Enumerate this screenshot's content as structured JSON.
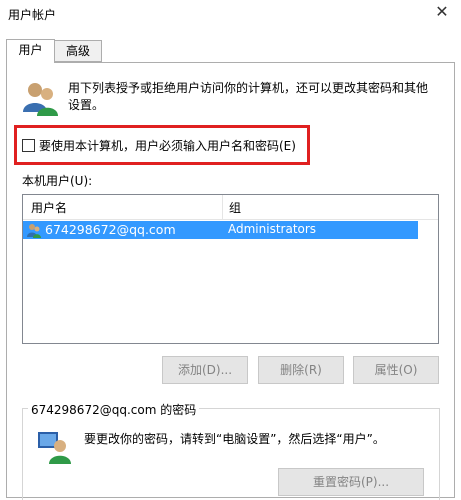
{
  "window": {
    "title": "用户帐户",
    "close_glyph": "✕"
  },
  "tabs": [
    {
      "label": "用户",
      "active": true
    },
    {
      "label": "高级",
      "active": false
    }
  ],
  "description": "用下列表授予或拒绝用户访问你的计算机，还可以更改其密码和其他设置。",
  "require_login": {
    "label": "要使用本计算机，用户必须输入用户名和密码(E)",
    "checked": false
  },
  "local_users": {
    "label": "本机用户(U):",
    "columns": [
      "用户名",
      "组"
    ],
    "rows": [
      {
        "name": "674298672@qq.com",
        "group": "Administrators",
        "selected": true
      }
    ]
  },
  "buttons": {
    "add": "添加(D)...",
    "remove": "删除(R)",
    "properties": "属性(O)"
  },
  "password_section": {
    "title": "674298672@qq.com 的密码",
    "text": "要更改你的密码，请转到“电脑设置”，然后选择“用户”。",
    "reset_button": "重置密码(P)..."
  },
  "colors": {
    "selection": "#3399ff",
    "highlight_box": "#e02020"
  },
  "icons": [
    "close-icon",
    "users-icon",
    "user-row-icon",
    "password-user-icon"
  ]
}
